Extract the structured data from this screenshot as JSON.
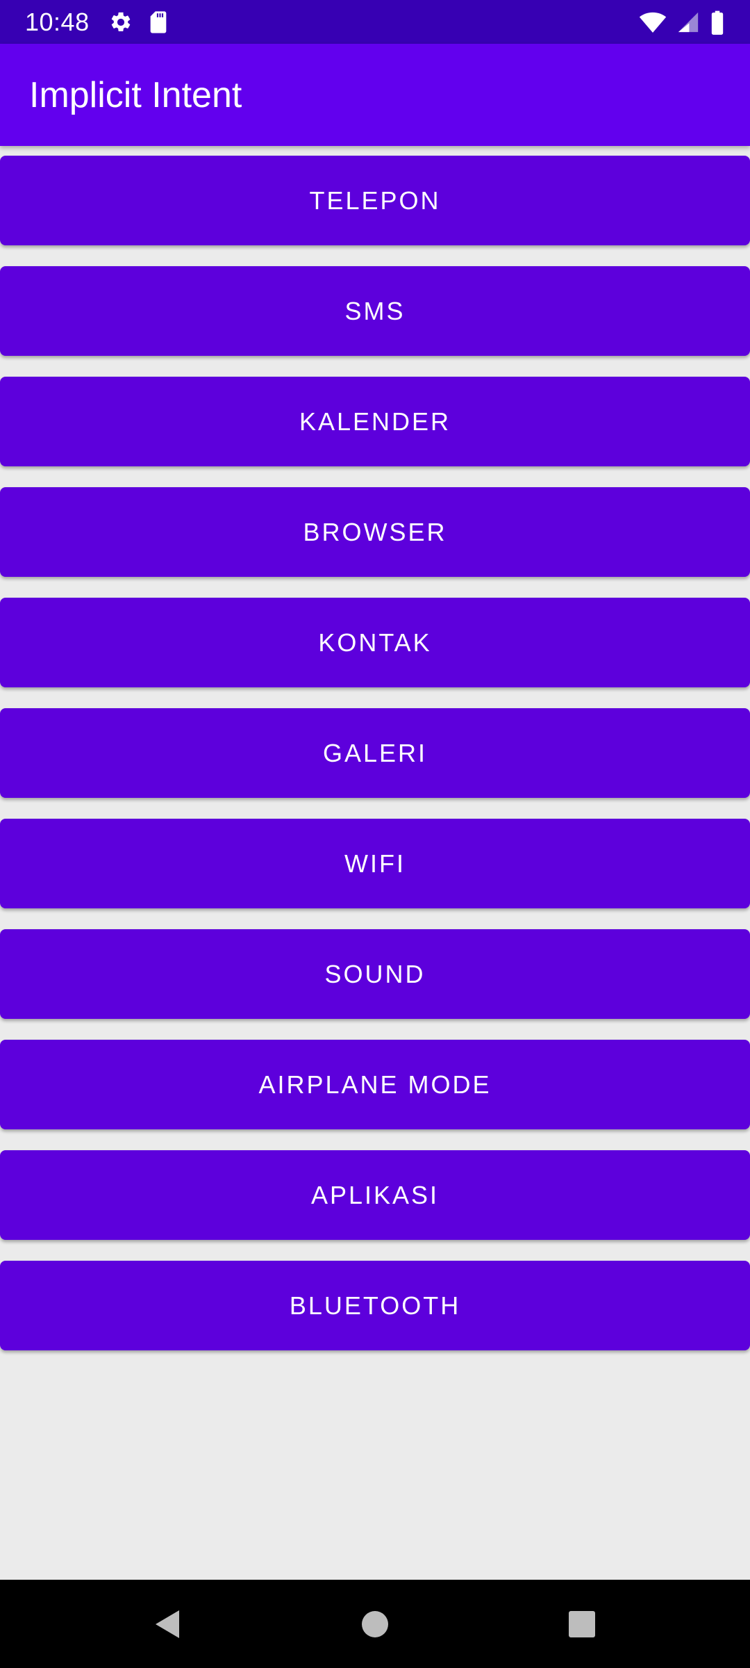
{
  "status_bar": {
    "time": "10:48",
    "left_icons": [
      "gear-icon",
      "sd-card-icon"
    ],
    "right_icons": [
      "wifi-icon",
      "cell-signal-icon",
      "battery-icon"
    ]
  },
  "app_bar": {
    "title": "Implicit Intent"
  },
  "buttons": [
    {
      "label": "TELEPON"
    },
    {
      "label": "SMS"
    },
    {
      "label": "KALENDER"
    },
    {
      "label": "BROWSER"
    },
    {
      "label": "KONTAK"
    },
    {
      "label": "GALERI"
    },
    {
      "label": "WIFI"
    },
    {
      "label": "SOUND"
    },
    {
      "label": "AIRPLANE MODE"
    },
    {
      "label": "APLIKASI"
    },
    {
      "label": "BLUETOOTH"
    }
  ],
  "nav_bar": {
    "items": [
      "back-icon",
      "home-icon",
      "recents-icon"
    ]
  },
  "colors": {
    "status_bar": "#3700b3",
    "app_bar": "#6200ee",
    "button": "#5d00dc",
    "background": "#ebebeb"
  }
}
